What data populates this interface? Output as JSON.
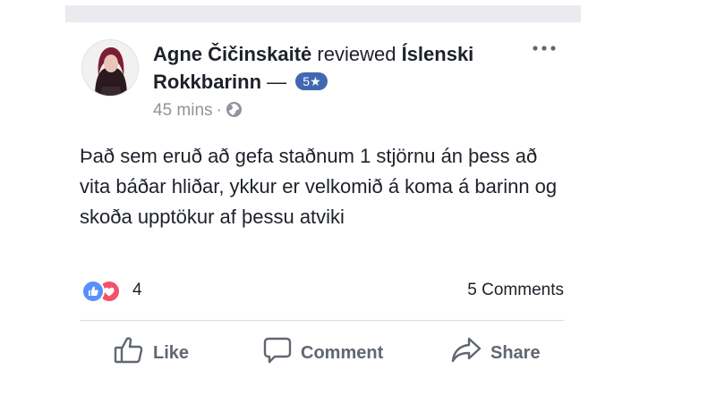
{
  "post": {
    "author": "Agne Čičinskaitė",
    "verb": "reviewed",
    "place": "Íslenski Rokkbarinn",
    "dash": "—",
    "rating": "5★",
    "time": "45 mins",
    "separator": "·",
    "privacy_icon": "globe-icon",
    "text": "Það sem eruð að gefa staðnum 1 stjörnu án þess að vita báðar hliðar, ykkur er velkomið á koma á barinn og skoða upptökur af þessu atviki"
  },
  "stats": {
    "reaction_count": "4",
    "reaction_icons": [
      "like-icon",
      "love-icon"
    ],
    "comments": "5 Comments"
  },
  "actions": {
    "like": "Like",
    "comment": "Comment",
    "share": "Share"
  },
  "colors": {
    "accent": "#4267b2",
    "like": "#5890ff",
    "love": "#f25268",
    "meta": "#90949c",
    "text": "#1d2129"
  }
}
